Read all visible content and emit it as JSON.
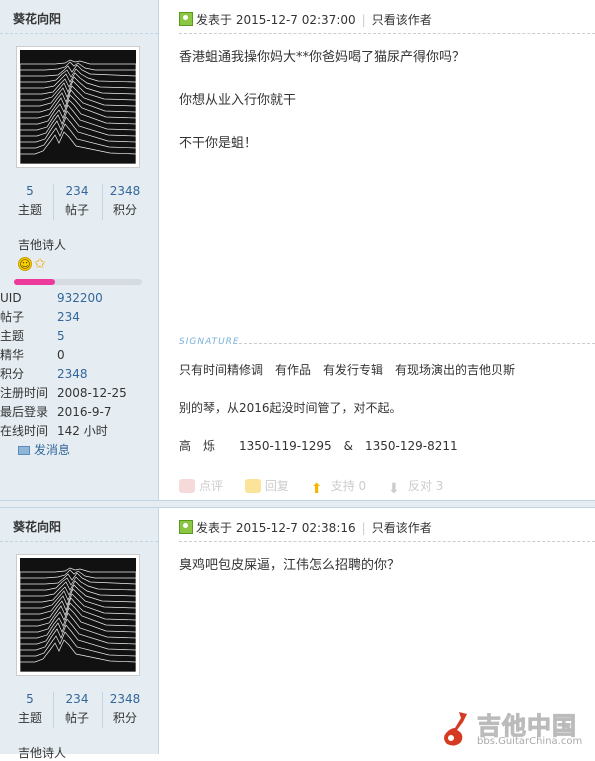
{
  "post1": {
    "author": "葵花向阳",
    "stats": [
      {
        "num": "5",
        "label": "主题"
      },
      {
        "num": "234",
        "label": "帖子"
      },
      {
        "num": "2348",
        "label": "积分"
      }
    ],
    "user_title": "吉他诗人",
    "level_progress": 0.32,
    "info": [
      {
        "key": "UID",
        "value": "932200"
      },
      {
        "key": "帖子",
        "value": "234"
      },
      {
        "key": "主题",
        "value": "5"
      },
      {
        "key": "精华",
        "value": "0"
      },
      {
        "key": "积分",
        "value": "2348"
      },
      {
        "key": "注册时间",
        "value": "2008-12-25"
      },
      {
        "key": "最后登录",
        "value": "2016-9-7"
      },
      {
        "key": "在线时间",
        "value": "142 小时"
      }
    ],
    "send_message": "发消息",
    "posted_at": "发表于 2015-12-7 02:37:00",
    "author_only": "只看该作者",
    "body": [
      "香港蛆通我操你妈大**你爸妈喝了猫尿产得你吗？",
      "你想从业入行你就干",
      "不干你是蛆！"
    ],
    "signature_label": "SIGNATURE",
    "signature": [
      "只有时间精修调　有作品　有发行专辑　有现场演出的吉他贝斯",
      "别的琴，从2016起没时间管了，对不起。",
      "高　烁　　1350-119-1295　&　1350-129-8211"
    ],
    "footer": {
      "rate": "点评",
      "reply": "回复",
      "support": "支持 0",
      "oppose": "反对 3"
    }
  },
  "post2": {
    "author": "葵花向阳",
    "stats": [
      {
        "num": "5",
        "label": "主题"
      },
      {
        "num": "234",
        "label": "帖子"
      },
      {
        "num": "2348",
        "label": "积分"
      }
    ],
    "user_title": "吉他诗人",
    "posted_at": "发表于 2015-12-7 02:38:16",
    "author_only": "只看该作者",
    "body": [
      "臭鸡吧包皮屎逼，江伟怎么招聘的你？"
    ]
  },
  "watermark": {
    "text": "吉他中国",
    "url": "bbs.GuitarChina.com"
  },
  "colors": {
    "sidebar_bg": "#e5edf2",
    "link": "#336699",
    "level_fill": "#ec3a9a"
  }
}
